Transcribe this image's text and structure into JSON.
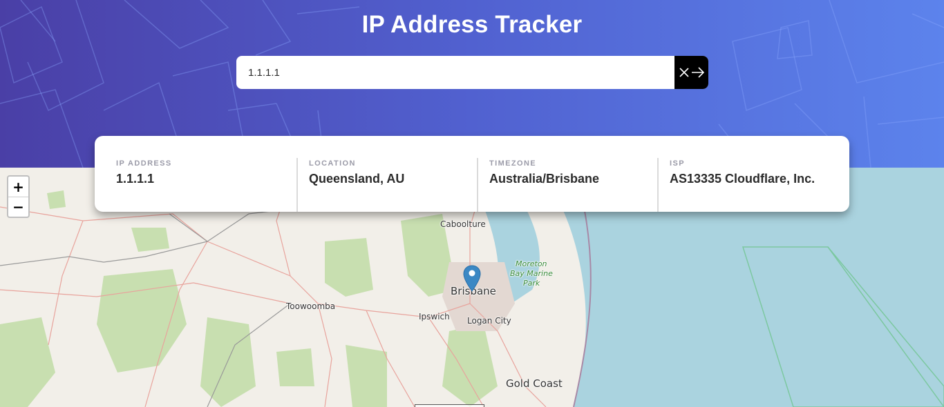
{
  "header": {
    "title": "IP Address Tracker"
  },
  "search": {
    "value": "1.1.1.1",
    "clear_icon": "close-icon",
    "submit_icon": "arrow-right-icon"
  },
  "info": [
    {
      "label": "IP ADDRESS",
      "value": "1.1.1.1"
    },
    {
      "label": "LOCATION",
      "value": "Queensland, AU"
    },
    {
      "label": "TIMEZONE",
      "value": "Australia/Brisbane"
    },
    {
      "label": "ISP",
      "value": "AS13335 Cloudflare, Inc."
    }
  ],
  "zoom": {
    "in_label": "+",
    "out_label": "−"
  },
  "map": {
    "labels": {
      "caboolture": "Caboolture",
      "brisbane": "Brisbane",
      "toowoomba": "Toowoomba",
      "ipswich": "Ipswich",
      "logan": "Logan City",
      "goldcoast": "Gold Coast",
      "moreton1": "Moreton",
      "moreton2": "Bay Marine",
      "moreton3": "Park"
    },
    "colors": {
      "land": "#f2efe9",
      "water": "#aad3df",
      "park": "#c8dfb0",
      "road": "#e8a39c",
      "header_start": "#4a3fa6",
      "header_end": "#5c83ec"
    }
  }
}
